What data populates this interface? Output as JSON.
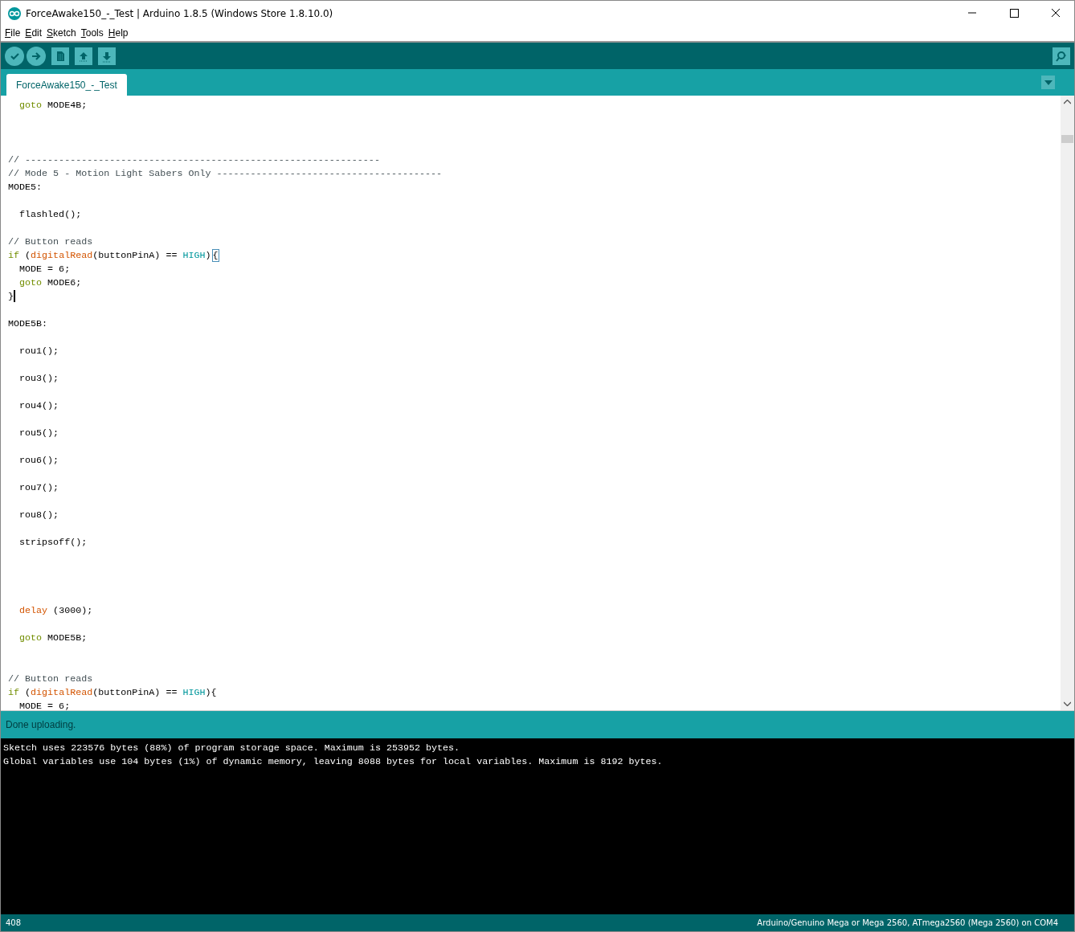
{
  "window": {
    "title": "ForceAwake150_-_Test | Arduino 1.8.5 (Windows Store 1.8.10.0)"
  },
  "menu": [
    {
      "label": "File"
    },
    {
      "label": "Edit"
    },
    {
      "label": "Sketch"
    },
    {
      "label": "Tools"
    },
    {
      "label": "Help"
    }
  ],
  "toolbar": [
    {
      "kind": "verify"
    },
    {
      "kind": "upload"
    },
    {
      "kind": "new"
    },
    {
      "kind": "open"
    },
    {
      "kind": "save"
    }
  ],
  "tabs": [
    {
      "label": "ForceAwake150_-_Test",
      "selected": true
    }
  ],
  "editor": {
    "lines": [
      {
        "kind": "code",
        "segments": [
          {
            "kind": "keyword",
            "text": "  goto"
          },
          {
            "kind": "plain",
            "text": " MODE4B;"
          }
        ]
      },
      {
        "kind": "blank"
      },
      {
        "kind": "blank"
      },
      {
        "kind": "blank"
      },
      {
        "kind": "code",
        "segments": [
          {
            "kind": "comment",
            "text": "// ---------------------------------------------------------------"
          }
        ]
      },
      {
        "kind": "code",
        "segments": [
          {
            "kind": "comment",
            "text": "// Mode 5 - Motion Light Sabers Only ----------------------------------------"
          }
        ]
      },
      {
        "kind": "code",
        "segments": [
          {
            "kind": "plain",
            "text": "MODE5:"
          }
        ]
      },
      {
        "kind": "blank"
      },
      {
        "kind": "code",
        "segments": [
          {
            "kind": "plain",
            "text": "  flashled();"
          }
        ]
      },
      {
        "kind": "blank"
      },
      {
        "kind": "code",
        "segments": [
          {
            "kind": "comment",
            "text": "// Button reads"
          }
        ]
      },
      {
        "kind": "code",
        "segments": [
          {
            "kind": "keyword",
            "text": "if"
          },
          {
            "kind": "plain",
            "text": " ("
          },
          {
            "kind": "function",
            "text": "digitalRead"
          },
          {
            "kind": "plain",
            "text": "(buttonPinA) == "
          },
          {
            "kind": "constant",
            "text": "HIGH"
          },
          {
            "kind": "plain",
            "text": ")"
          },
          {
            "kind": "matched",
            "text": "{"
          }
        ]
      },
      {
        "kind": "code",
        "segments": [
          {
            "kind": "plain",
            "text": "  MODE = 6;"
          }
        ]
      },
      {
        "kind": "code",
        "segments": [
          {
            "kind": "keyword",
            "text": "  goto"
          },
          {
            "kind": "plain",
            "text": " MODE6;"
          }
        ]
      },
      {
        "kind": "code",
        "segments": [
          {
            "kind": "plain",
            "text": "}"
          },
          {
            "kind": "caret"
          }
        ]
      },
      {
        "kind": "blank"
      },
      {
        "kind": "code",
        "segments": [
          {
            "kind": "plain",
            "text": "MODE5B:"
          }
        ]
      },
      {
        "kind": "blank"
      },
      {
        "kind": "code",
        "segments": [
          {
            "kind": "plain",
            "text": "  rou1();"
          }
        ]
      },
      {
        "kind": "blank"
      },
      {
        "kind": "code",
        "segments": [
          {
            "kind": "plain",
            "text": "  rou3();"
          }
        ]
      },
      {
        "kind": "blank"
      },
      {
        "kind": "code",
        "segments": [
          {
            "kind": "plain",
            "text": "  rou4();"
          }
        ]
      },
      {
        "kind": "blank"
      },
      {
        "kind": "code",
        "segments": [
          {
            "kind": "plain",
            "text": "  rou5();"
          }
        ]
      },
      {
        "kind": "blank"
      },
      {
        "kind": "code",
        "segments": [
          {
            "kind": "plain",
            "text": "  rou6();"
          }
        ]
      },
      {
        "kind": "blank"
      },
      {
        "kind": "code",
        "segments": [
          {
            "kind": "plain",
            "text": "  rou7();"
          }
        ]
      },
      {
        "kind": "blank"
      },
      {
        "kind": "code",
        "segments": [
          {
            "kind": "plain",
            "text": "  rou8();"
          }
        ]
      },
      {
        "kind": "blank"
      },
      {
        "kind": "code",
        "segments": [
          {
            "kind": "plain",
            "text": "  stripsoff();"
          }
        ]
      },
      {
        "kind": "blank"
      },
      {
        "kind": "blank"
      },
      {
        "kind": "blank"
      },
      {
        "kind": "blank"
      },
      {
        "kind": "code",
        "segments": [
          {
            "kind": "function",
            "text": "  delay"
          },
          {
            "kind": "plain",
            "text": " (3000);"
          }
        ]
      },
      {
        "kind": "blank"
      },
      {
        "kind": "code",
        "segments": [
          {
            "kind": "keyword",
            "text": "  goto"
          },
          {
            "kind": "plain",
            "text": " MODE5B;"
          }
        ]
      },
      {
        "kind": "blank"
      },
      {
        "kind": "blank"
      },
      {
        "kind": "code",
        "segments": [
          {
            "kind": "comment",
            "text": "// Button reads"
          }
        ]
      },
      {
        "kind": "code",
        "segments": [
          {
            "kind": "keyword",
            "text": "if"
          },
          {
            "kind": "plain",
            "text": " ("
          },
          {
            "kind": "function",
            "text": "digitalRead"
          },
          {
            "kind": "plain",
            "text": "(buttonPinA) == "
          },
          {
            "kind": "constant",
            "text": "HIGH"
          },
          {
            "kind": "plain",
            "text": "){"
          }
        ]
      },
      {
        "kind": "code",
        "segments": [
          {
            "kind": "plain",
            "text": "  MODE = 6;"
          }
        ]
      }
    ]
  },
  "status": "Done uploading.",
  "console": [
    "Sketch uses 223576 bytes (88%) of program storage space. Maximum is 253952 bytes.",
    "Global variables use 104 bytes (1%) of dynamic memory, leaving 8088 bytes for local variables. Maximum is 8192 bytes."
  ],
  "footer": {
    "line": "408",
    "board": "Arduino/Genuino Mega or Mega 2560, ATmega2560 (Mega 2560) on COM4"
  }
}
